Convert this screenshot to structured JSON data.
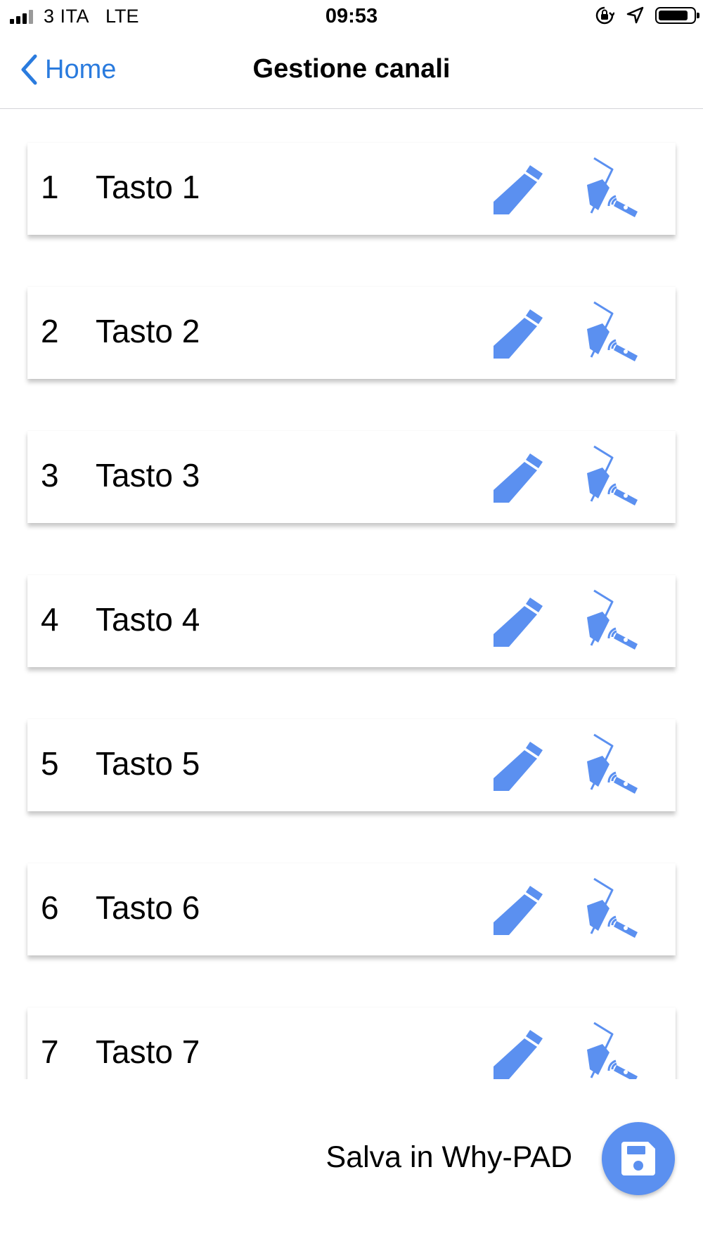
{
  "status_bar": {
    "carrier": "3 ITA",
    "network": "LTE",
    "time": "09:53"
  },
  "nav": {
    "back_label": "Home",
    "title": "Gestione canali"
  },
  "channels": [
    {
      "number": "1",
      "label": "Tasto 1"
    },
    {
      "number": "2",
      "label": "Tasto 2"
    },
    {
      "number": "3",
      "label": "Tasto 3"
    },
    {
      "number": "4",
      "label": "Tasto 4"
    },
    {
      "number": "5",
      "label": "Tasto 5"
    },
    {
      "number": "6",
      "label": "Tasto 6"
    },
    {
      "number": "7",
      "label": "Tasto 7"
    }
  ],
  "footer": {
    "save_label": "Salva in Why-PAD"
  },
  "colors": {
    "accent": "#2a7bde",
    "icon_blue": "#5b90f0"
  },
  "icons": {
    "edit": "pencil-icon",
    "learn": "remote-learn-icon",
    "save": "floppy-disk-icon",
    "back": "chevron-left-icon"
  }
}
